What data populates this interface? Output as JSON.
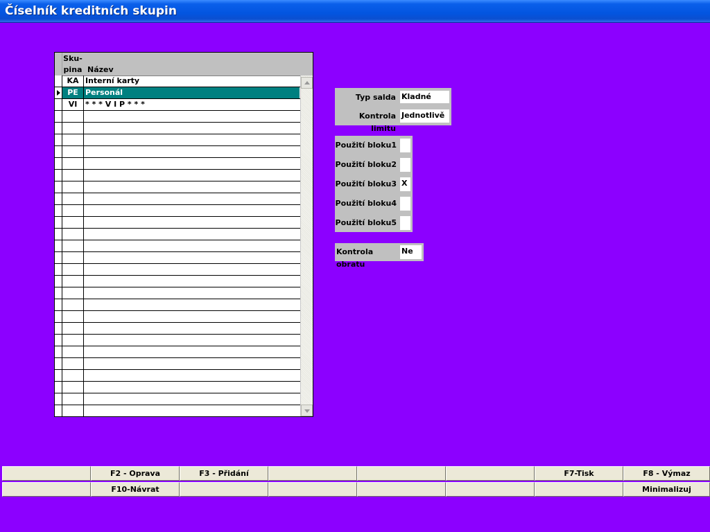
{
  "window": {
    "title": "Číselník kreditních skupin"
  },
  "grid": {
    "header_code_line1": "Sku-",
    "header_code_line2": "pina",
    "header_name": "Název",
    "rows": [
      {
        "code": "KA",
        "name": "Interní karty"
      },
      {
        "code": "PE",
        "name": "Personál"
      },
      {
        "code": "VI",
        "name": "* * * V I P * * *"
      }
    ],
    "selected_index": 1,
    "empty_rows": 26
  },
  "details": {
    "typ_salda_label": "Typ salda",
    "typ_salda_value": "Kladné",
    "kontrola_limitu_label": "Kontrola limitu",
    "kontrola_limitu_value": "Jednotlivě",
    "bloky": [
      {
        "label": "Použití bloku1",
        "value": ""
      },
      {
        "label": "Použití bloku2",
        "value": ""
      },
      {
        "label": "Použití bloku3",
        "value": "X"
      },
      {
        "label": "Použití bloku4",
        "value": ""
      },
      {
        "label": "Použití bloku5",
        "value": ""
      }
    ],
    "kontrola_obratu_label": "Kontrola obratu",
    "kontrola_obratu_value": "Ne"
  },
  "buttons_row1": [
    "",
    "F2 - Oprava",
    "F3 - Přidání",
    "",
    "",
    "",
    "F7-Tisk",
    "F8 - Výmaz"
  ],
  "buttons_row2": [
    "",
    "F10-Návrat",
    "",
    "",
    "",
    "",
    "",
    "Minimalizuj"
  ],
  "colors": {
    "background": "#8C00FF",
    "selection": "#008080",
    "panel": "#C0C0C0",
    "title_bar": "#0355E0"
  }
}
